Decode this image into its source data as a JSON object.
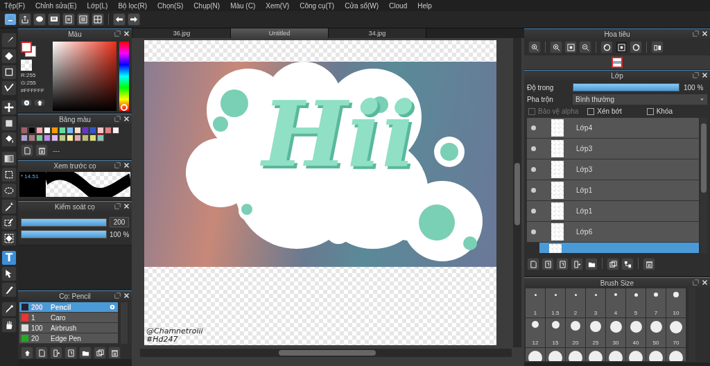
{
  "menu": [
    "Tệp(F)",
    "Chỉnh sửa(E)",
    "Lớp(L)",
    "Bộ lọc(R)",
    "Chọn(S)",
    "Chụp(N)",
    "Màu (C)",
    "Xem(V)",
    "Công cụ(T)",
    "Cửa sổ(W)",
    "Cloud",
    "Help"
  ],
  "tools": [
    {
      "kind": "brush",
      "selected": false
    },
    {
      "kind": "eraser",
      "selected": false
    },
    {
      "kind": "rect",
      "selected": false
    },
    {
      "kind": "polyline",
      "selected": false
    },
    {
      "kind": "move",
      "selected": false
    },
    {
      "kind": "fill-rect",
      "selected": false
    },
    {
      "kind": "bucket",
      "selected": false
    },
    {
      "kind": "gradient",
      "selected": false
    },
    {
      "kind": "select-rect",
      "selected": false
    },
    {
      "kind": "lasso",
      "selected": false
    },
    {
      "kind": "wand",
      "selected": false
    },
    {
      "kind": "select-pen",
      "selected": false
    },
    {
      "kind": "select-eraser",
      "selected": false
    },
    {
      "kind": "text",
      "selected": true
    },
    {
      "kind": "pointer",
      "selected": false
    },
    {
      "kind": "knife",
      "selected": false
    },
    {
      "kind": "eyedropper",
      "selected": false
    },
    {
      "kind": "hand",
      "selected": false
    }
  ],
  "text_tool_glyph": "T",
  "color_panel": {
    "title": "Màu",
    "readout": [
      "R:255",
      "G:255"
    ],
    "hex": "#FFFFFF",
    "hue": {
      "level": 0
    }
  },
  "palette": {
    "title": "Bảng màu",
    "field": "---",
    "swatches": [
      {
        "color": "#a0606a",
        "selected": false
      },
      {
        "color": "#000000",
        "selected": false
      },
      {
        "color": "#f4a8b0",
        "selected": false
      },
      {
        "color": "#ffffff",
        "selected": false
      },
      {
        "color": "#ff9900",
        "selected": false
      },
      {
        "color": "#66dd99",
        "selected": false
      },
      {
        "color": "#77bbee",
        "selected": false
      },
      {
        "color": "#f8e0c8",
        "selected": false
      },
      {
        "color": "#6633cc",
        "selected": false
      },
      {
        "color": "#3355cc",
        "selected": false
      },
      {
        "color": "#f8c8c8",
        "selected": false
      },
      {
        "color": "#e08080",
        "selected": false
      },
      {
        "color": "#fff0f0",
        "selected": false
      },
      {
        "color": "#b0a0d0",
        "selected": false
      },
      {
        "color": "#b07880",
        "selected": false
      },
      {
        "color": "#77cc99",
        "selected": false
      },
      {
        "color": "#bb88ee",
        "selected": false
      },
      {
        "color": "#ddbbee",
        "selected": false
      },
      {
        "color": "#bbcc88",
        "selected": false
      },
      {
        "color": "#ffee99",
        "selected": false
      },
      {
        "color": "#ddaaaa",
        "selected": false
      },
      {
        "color": "#bbbb77",
        "selected": false
      },
      {
        "color": "#dddd77",
        "selected": false
      },
      {
        "color": "#77ccbb",
        "selected": true
      }
    ]
  },
  "brush_preview": {
    "title": "Xem trước cọ",
    "size": "* 14.51"
  },
  "brush_control": {
    "title": "Kiểm soát cọ",
    "size": {
      "level": 1,
      "value": "200"
    },
    "opacity": {
      "level": 1,
      "reading": "100 %"
    }
  },
  "brushes": {
    "title": "Cọ: Pencil",
    "items": [
      {
        "size": "200",
        "name": "Pencil",
        "color": "#222233",
        "selected": true
      },
      {
        "size": "1",
        "name": "Caro",
        "color": "#ee3333",
        "selected": false
      },
      {
        "size": "100",
        "name": "Airbrush",
        "color": "#dddddd",
        "selected": false
      },
      {
        "size": "20",
        "name": "Edge Pen",
        "color": "#22aa22",
        "selected": false
      }
    ]
  },
  "tabs": [
    {
      "label": "36.jpg",
      "selected": false
    },
    {
      "label": "Untitled",
      "selected": true
    },
    {
      "label": "34.jpg",
      "selected": false
    }
  ],
  "canvas": {
    "art_title": "Hii",
    "credits": [
      "@Chamnetroiii",
      "#Hd247"
    ]
  },
  "navigator": {
    "title": "Hoa tiêu"
  },
  "layers": {
    "title": "Lớp",
    "opacity": {
      "label": "Độ trong",
      "level": 1,
      "reading": "100 %"
    },
    "blend": {
      "label": "Pha trộn",
      "value": "Bình thường"
    },
    "options": [
      {
        "label": "Bảo vệ alpha",
        "checked": false,
        "disabled": true
      },
      {
        "label": "Xén bớt",
        "checked": false,
        "disabled": false
      },
      {
        "label": "Khóa",
        "checked": false,
        "disabled": false
      }
    ],
    "items": [
      {
        "name": "Lớp4",
        "selected": false
      },
      {
        "name": "Lớp3",
        "selected": false
      },
      {
        "name": "Lớp3",
        "selected": false
      },
      {
        "name": "Lớp1",
        "selected": false
      },
      {
        "name": "Lớp1",
        "selected": false
      },
      {
        "name": "Lớp6",
        "selected": false
      },
      {
        "selected": true
      }
    ]
  },
  "brush_size": {
    "title": "Brush Size",
    "sizes": [
      "1",
      "1.5",
      "2",
      "3",
      "4",
      "5",
      "7",
      "10",
      "12",
      "15",
      "20",
      "25",
      "30",
      "40",
      "50",
      "70"
    ]
  }
}
